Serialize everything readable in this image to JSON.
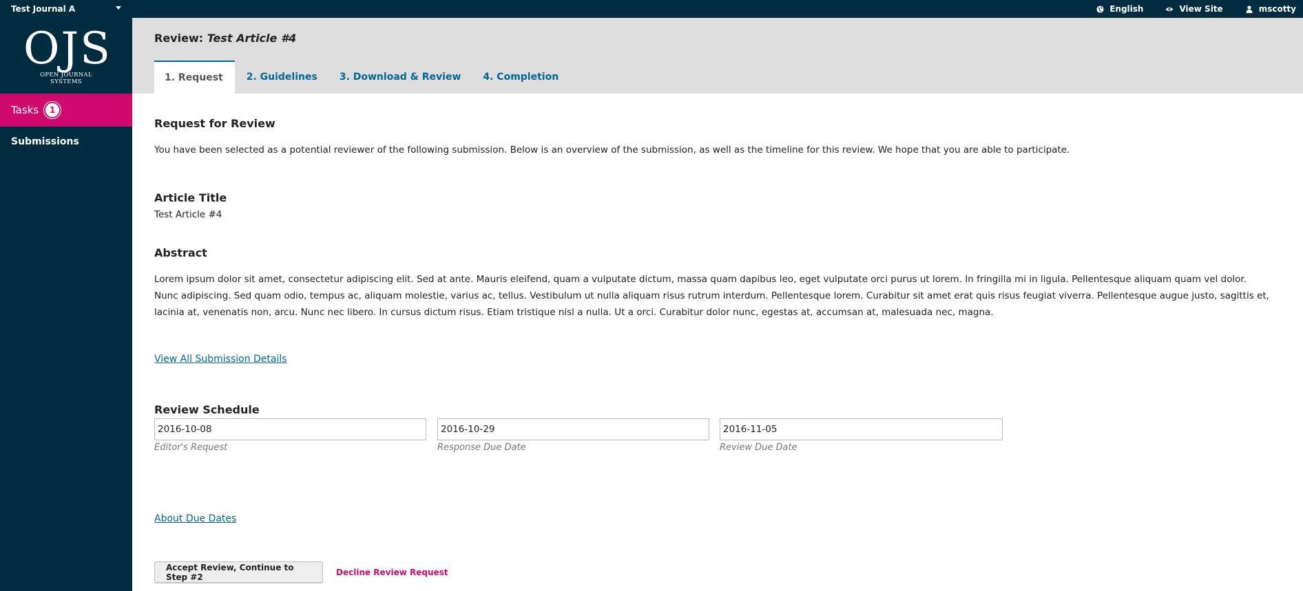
{
  "topbar": {
    "journal_name": "Test Journal A",
    "language": "English",
    "view_site": "View Site",
    "username": "mscotty"
  },
  "sidebar": {
    "logo_main": "OJS",
    "logo_sub": "OPEN JOURNAL SYSTEMS",
    "tasks_label": "Tasks",
    "tasks_count": "1",
    "submissions_label": "Submissions"
  },
  "header": {
    "title_prefix": "Review:",
    "title_article": "Test Article #4",
    "tabs": [
      {
        "label": "1. Request"
      },
      {
        "label": "2. Guidelines"
      },
      {
        "label": "3. Download & Review"
      },
      {
        "label": "4. Completion"
      }
    ]
  },
  "main": {
    "request_heading": "Request for Review",
    "request_text": "You have been selected as a potential reviewer of the following submission. Below is an overview of the submission, as well as the timeline for this review. We hope that you are able to participate.",
    "article_title_heading": "Article Title",
    "article_title_value": "Test Article #4",
    "abstract_heading": "Abstract",
    "abstract_text": "Lorem ipsum dolor sit amet, consectetur adipiscing elit. Sed at ante. Mauris eleifend, quam a vulputate dictum, massa quam dapibus leo, eget vulputate orci purus ut lorem. In fringilla mi in ligula. Pellentesque aliquam quam vel dolor. Nunc adipiscing. Sed quam odio, tempus ac, aliquam molestie, varius ac, tellus. Vestibulum ut nulla aliquam risus rutrum interdum. Pellentesque lorem. Curabitur sit amet erat quis risus feugiat viverra. Pellentesque augue justo, sagittis et, lacinia at, venenatis non, arcu. Nunc nec libero. In cursus dictum risus. Etiam tristique nisl a nulla. Ut a orci. Curabitur dolor nunc, egestas at, accumsan at, malesuada nec, magna.",
    "view_details_link": "View All Submission Details",
    "schedule_heading": "Review Schedule",
    "schedule": [
      {
        "value": "2016-10-08",
        "label": "Editor's Request"
      },
      {
        "value": "2016-10-29",
        "label": "Response Due Date"
      },
      {
        "value": "2016-11-05",
        "label": "Review Due Date"
      }
    ],
    "about_due_dates_link": "About Due Dates",
    "accept_button": "Accept Review, Continue to Step #2",
    "decline_link": "Decline Review Request"
  },
  "colors": {
    "nav_bg": "#002c40",
    "accent": "#d00a6c",
    "link": "#006798"
  }
}
